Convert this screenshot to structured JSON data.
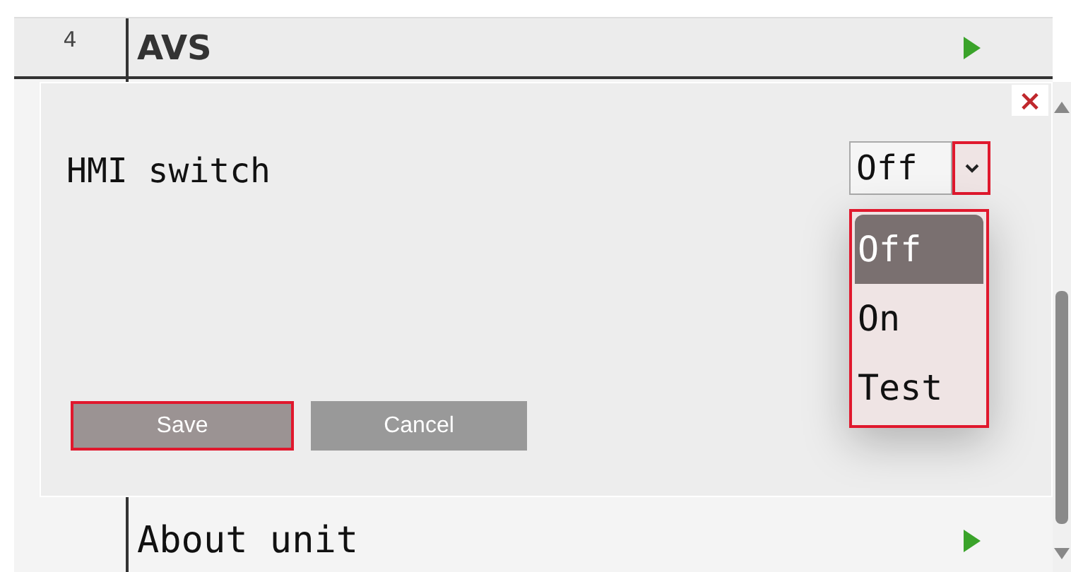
{
  "list": {
    "rows": [
      {
        "kind": "header",
        "number": "4",
        "label": "AVS"
      },
      {
        "kind": "item",
        "label": "About unit"
      }
    ]
  },
  "dialog": {
    "close": "×",
    "field_label": "HMI switch",
    "select": {
      "value": "Off",
      "expanded": true,
      "options": [
        {
          "label": "Off",
          "selected": true
        },
        {
          "label": "On",
          "selected": false
        },
        {
          "label": "Test",
          "selected": false
        }
      ]
    },
    "buttons": [
      {
        "label": "Save",
        "focused": true
      },
      {
        "label": "Cancel",
        "focused": false
      }
    ]
  }
}
